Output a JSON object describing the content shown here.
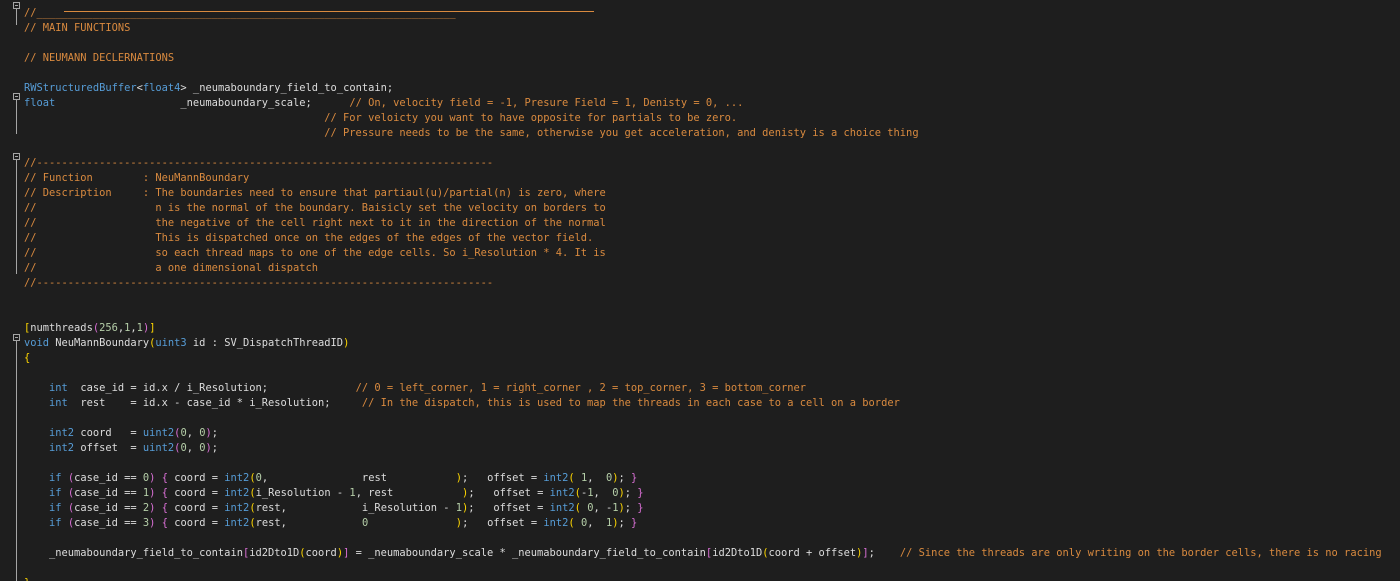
{
  "editor": {
    "lines": [
      {
        "row": 0,
        "text": "//___________________________________________________________________",
        "cls": "cm"
      },
      {
        "row": 1,
        "text": "// MAIN FUNCTIONS",
        "cls": "cm"
      },
      {
        "row": 3,
        "text": "// NEUMANN DECLERNATIONS",
        "cls": "cm"
      },
      {
        "row": 5,
        "parts": [
          [
            "kw",
            "RWStructuredBuffer"
          ],
          [
            "plain",
            "<"
          ],
          [
            "kw",
            "float4"
          ],
          [
            "plain",
            "> _neumaboundary_field_to_contain;"
          ]
        ]
      },
      {
        "row": 6,
        "parts": [
          [
            "kw",
            "float"
          ],
          [
            "plain",
            "                    _neumaboundary_scale;      "
          ],
          [
            "cm",
            "// On, velocity field = -1, Presure Field = 1, Denisty = 0, ..."
          ]
        ]
      },
      {
        "row": 7,
        "parts": [
          [
            "plain",
            "                                                "
          ],
          [
            "cm",
            "// For veloicty you want to have opposite for partials to be zero."
          ]
        ]
      },
      {
        "row": 8,
        "parts": [
          [
            "plain",
            "                                                "
          ],
          [
            "cm",
            "// Pressure needs to be the same, otherwise you get acceleration, and denisty is a choice thing"
          ]
        ]
      },
      {
        "row": 10,
        "text": "//-------------------------------------------------------------------------",
        "cls": "cm"
      },
      {
        "row": 11,
        "text": "// Function        : NeuMannBoundary",
        "cls": "cm"
      },
      {
        "row": 12,
        "text": "// Description     : The boundaries need to ensure that partiaul(u)/partial(n) is zero, where",
        "cls": "cm"
      },
      {
        "row": 13,
        "text": "//                   n is the normal of the boundary. Baisicly set the velocity on borders to",
        "cls": "cm"
      },
      {
        "row": 14,
        "text": "//                   the negative of the cell right next to it in the direction of the normal",
        "cls": "cm"
      },
      {
        "row": 15,
        "text": "//                   This is dispatched once on the edges of the edges of the vector field.",
        "cls": "cm"
      },
      {
        "row": 16,
        "text": "//                   so each thread maps to one of the edge cells. So i_Resolution * 4. It is",
        "cls": "cm"
      },
      {
        "row": 17,
        "text": "//                   a one dimensional dispatch",
        "cls": "cm"
      },
      {
        "row": 18,
        "text": "//-------------------------------------------------------------------------",
        "cls": "cm"
      },
      {
        "row": 21,
        "parts": [
          [
            "br1",
            "["
          ],
          [
            "plain",
            "numthreads"
          ],
          [
            "br2",
            "("
          ],
          [
            "num",
            "256"
          ],
          [
            "plain",
            ","
          ],
          [
            "num",
            "1"
          ],
          [
            "plain",
            ","
          ],
          [
            "num",
            "1"
          ],
          [
            "br2",
            ")"
          ],
          [
            "br1",
            "]"
          ]
        ]
      },
      {
        "row": 22,
        "parts": [
          [
            "kw",
            "void"
          ],
          [
            "plain",
            " NeuMannBoundary"
          ],
          [
            "br1",
            "("
          ],
          [
            "kw",
            "uint3"
          ],
          [
            "plain",
            " id : SV_DispatchThreadID"
          ],
          [
            "br1",
            ")"
          ]
        ]
      },
      {
        "row": 23,
        "parts": [
          [
            "br1",
            "{"
          ]
        ]
      },
      {
        "row": 25,
        "parts": [
          [
            "plain",
            "    "
          ],
          [
            "kw",
            "int"
          ],
          [
            "plain",
            "  case_id = id.x / i_Resolution;              "
          ],
          [
            "cm",
            "// 0 = left_corner, 1 = right_corner , 2 = top_corner, 3 = bottom_corner"
          ]
        ]
      },
      {
        "row": 26,
        "parts": [
          [
            "plain",
            "    "
          ],
          [
            "kw",
            "int"
          ],
          [
            "plain",
            "  rest    = id.x - case_id * i_Resolution;     "
          ],
          [
            "cm",
            "// In the dispatch, this is used to map the threads in each case to a cell on a border"
          ]
        ]
      },
      {
        "row": 28,
        "parts": [
          [
            "plain",
            "    "
          ],
          [
            "kw",
            "int2"
          ],
          [
            "plain",
            " coord   = "
          ],
          [
            "kw",
            "uint2"
          ],
          [
            "br2",
            "("
          ],
          [
            "num",
            "0"
          ],
          [
            "plain",
            ", "
          ],
          [
            "num",
            "0"
          ],
          [
            "br2",
            ")"
          ],
          [
            "plain",
            ";"
          ]
        ]
      },
      {
        "row": 29,
        "parts": [
          [
            "plain",
            "    "
          ],
          [
            "kw",
            "int2"
          ],
          [
            "plain",
            " offset  = "
          ],
          [
            "kw",
            "uint2"
          ],
          [
            "br2",
            "("
          ],
          [
            "num",
            "0"
          ],
          [
            "plain",
            ", "
          ],
          [
            "num",
            "0"
          ],
          [
            "br2",
            ")"
          ],
          [
            "plain",
            ";"
          ]
        ]
      },
      {
        "row": 31,
        "parts": [
          [
            "plain",
            "    "
          ],
          [
            "kw",
            "if"
          ],
          [
            "plain",
            " "
          ],
          [
            "br2",
            "("
          ],
          [
            "plain",
            "case_id == "
          ],
          [
            "num",
            "0"
          ],
          [
            "br2",
            ")"
          ],
          [
            "plain",
            " "
          ],
          [
            "br2",
            "{"
          ],
          [
            "plain",
            " coord = "
          ],
          [
            "kw",
            "int2"
          ],
          [
            "br1",
            "("
          ],
          [
            "num",
            "0"
          ],
          [
            "plain",
            ",               rest           "
          ],
          [
            "br1",
            ")"
          ],
          [
            "plain",
            ";   offset = "
          ],
          [
            "kw",
            "int2"
          ],
          [
            "br1",
            "("
          ],
          [
            "plain",
            " "
          ],
          [
            "num",
            "1"
          ],
          [
            "plain",
            ",  "
          ],
          [
            "num",
            "0"
          ],
          [
            "br1",
            ")"
          ],
          [
            "plain",
            "; "
          ],
          [
            "br2",
            "}"
          ]
        ]
      },
      {
        "row": 32,
        "parts": [
          [
            "plain",
            "    "
          ],
          [
            "kw",
            "if"
          ],
          [
            "plain",
            " "
          ],
          [
            "br2",
            "("
          ],
          [
            "plain",
            "case_id == "
          ],
          [
            "num",
            "1"
          ],
          [
            "br2",
            ")"
          ],
          [
            "plain",
            " "
          ],
          [
            "br2",
            "{"
          ],
          [
            "plain",
            " coord = "
          ],
          [
            "kw",
            "int2"
          ],
          [
            "br1",
            "("
          ],
          [
            "plain",
            "i_Resolution - "
          ],
          [
            "num",
            "1"
          ],
          [
            "plain",
            ", rest           "
          ],
          [
            "br1",
            ")"
          ],
          [
            "plain",
            ";   offset = "
          ],
          [
            "kw",
            "int2"
          ],
          [
            "br1",
            "("
          ],
          [
            "plain",
            "-"
          ],
          [
            "num",
            "1"
          ],
          [
            "plain",
            ",  "
          ],
          [
            "num",
            "0"
          ],
          [
            "br1",
            ")"
          ],
          [
            "plain",
            "; "
          ],
          [
            "br2",
            "}"
          ]
        ]
      },
      {
        "row": 33,
        "parts": [
          [
            "plain",
            "    "
          ],
          [
            "kw",
            "if"
          ],
          [
            "plain",
            " "
          ],
          [
            "br2",
            "("
          ],
          [
            "plain",
            "case_id == "
          ],
          [
            "num",
            "2"
          ],
          [
            "br2",
            ")"
          ],
          [
            "plain",
            " "
          ],
          [
            "br2",
            "{"
          ],
          [
            "plain",
            " coord = "
          ],
          [
            "kw",
            "int2"
          ],
          [
            "br1",
            "("
          ],
          [
            "plain",
            "rest,            i_Resolution - "
          ],
          [
            "num",
            "1"
          ],
          [
            "br1",
            ")"
          ],
          [
            "plain",
            ";   offset = "
          ],
          [
            "kw",
            "int2"
          ],
          [
            "br1",
            "("
          ],
          [
            "plain",
            " "
          ],
          [
            "num",
            "0"
          ],
          [
            "plain",
            ", -"
          ],
          [
            "num",
            "1"
          ],
          [
            "br1",
            ")"
          ],
          [
            "plain",
            "; "
          ],
          [
            "br2",
            "}"
          ]
        ]
      },
      {
        "row": 34,
        "parts": [
          [
            "plain",
            "    "
          ],
          [
            "kw",
            "if"
          ],
          [
            "plain",
            " "
          ],
          [
            "br2",
            "("
          ],
          [
            "plain",
            "case_id == "
          ],
          [
            "num",
            "3"
          ],
          [
            "br2",
            ")"
          ],
          [
            "plain",
            " "
          ],
          [
            "br2",
            "{"
          ],
          [
            "plain",
            " coord = "
          ],
          [
            "kw",
            "int2"
          ],
          [
            "br1",
            "("
          ],
          [
            "plain",
            "rest,            "
          ],
          [
            "num",
            "0"
          ],
          [
            "plain",
            "              "
          ],
          [
            "br1",
            ")"
          ],
          [
            "plain",
            ";   offset = "
          ],
          [
            "kw",
            "int2"
          ],
          [
            "br1",
            "("
          ],
          [
            "plain",
            " "
          ],
          [
            "num",
            "0"
          ],
          [
            "plain",
            ",  "
          ],
          [
            "num",
            "1"
          ],
          [
            "br1",
            ")"
          ],
          [
            "plain",
            "; "
          ],
          [
            "br2",
            "}"
          ]
        ]
      },
      {
        "row": 36,
        "parts": [
          [
            "plain",
            "    _neumaboundary_field_to_contain"
          ],
          [
            "br2",
            "["
          ],
          [
            "plain",
            "id2Dto1D"
          ],
          [
            "br1",
            "("
          ],
          [
            "plain",
            "coord"
          ],
          [
            "br1",
            ")"
          ],
          [
            "br2",
            "]"
          ],
          [
            "plain",
            " = _neumaboundary_scale * _neumaboundary_field_to_contain"
          ],
          [
            "br2",
            "["
          ],
          [
            "plain",
            "id2Dto1D"
          ],
          [
            "br1",
            "("
          ],
          [
            "plain",
            "coord + offset"
          ],
          [
            "br1",
            ")"
          ],
          [
            "br2",
            "]"
          ],
          [
            "plain",
            ";    "
          ],
          [
            "cm",
            "// Since the threads are only writing on the border cells, there is no racing"
          ]
        ]
      },
      {
        "row": 38,
        "parts": [
          [
            "br1",
            "}"
          ]
        ]
      }
    ]
  }
}
